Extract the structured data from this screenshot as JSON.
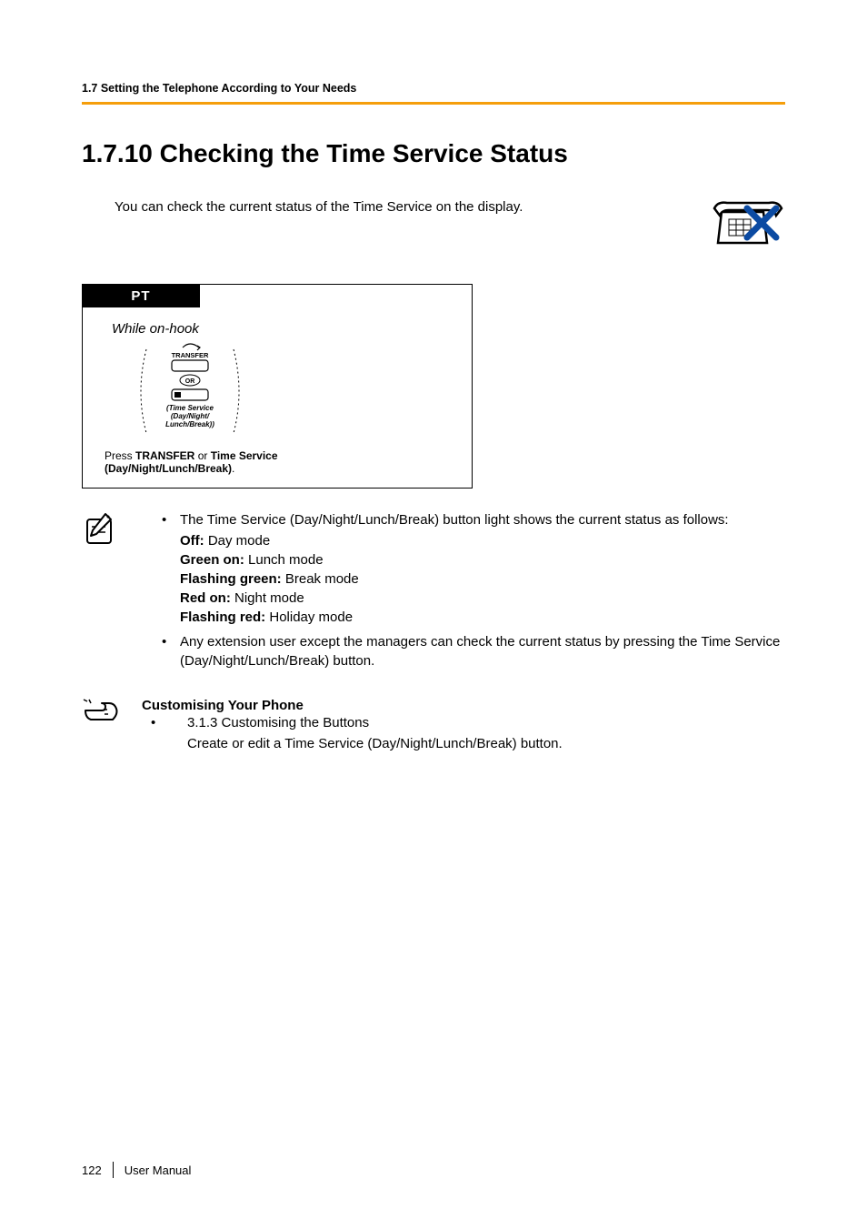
{
  "header": {
    "section_label": "1.7 Setting the Telephone According to Your Needs"
  },
  "title": "1.7.10  Checking the Time Service Status",
  "intro": "You can check the current status of the Time Service on the display.",
  "procedure": {
    "tab": "PT",
    "state": "While on-hook",
    "transfer_label": "TRANSFER",
    "or_label": "OR",
    "svc_line1": "(Time Service",
    "svc_line2": "(Day/Night/",
    "svc_line3": "Lunch/Break))",
    "press_prefix": "Press ",
    "press_bold1": "TRANSFER",
    "press_mid": " or ",
    "press_bold2": "Time Service",
    "press_tail": "(Day/Night/Lunch/Break)",
    "press_period": "."
  },
  "notes": {
    "lead": "The Time Service (Day/Night/Lunch/Break) button light shows the current status as follows:",
    "statuses": [
      {
        "label": "Off:",
        "desc": " Day mode"
      },
      {
        "label": "Green on:",
        "desc": " Lunch mode"
      },
      {
        "label": "Flashing green:",
        "desc": " Break mode"
      },
      {
        "label": "Red on:",
        "desc": " Night mode"
      },
      {
        "label": "Flashing red:",
        "desc": " Holiday mode"
      }
    ],
    "bullet2": "Any extension user except the managers can check the current status by pressing the Time Service (Day/Night/Lunch/Break) button."
  },
  "customising": {
    "title": "Customising Your Phone",
    "item": "3.1.3 Customising the Buttons",
    "desc": "Create or edit a Time Service (Day/Night/Lunch/Break) button."
  },
  "footer": {
    "page": "122",
    "label": "User Manual"
  }
}
